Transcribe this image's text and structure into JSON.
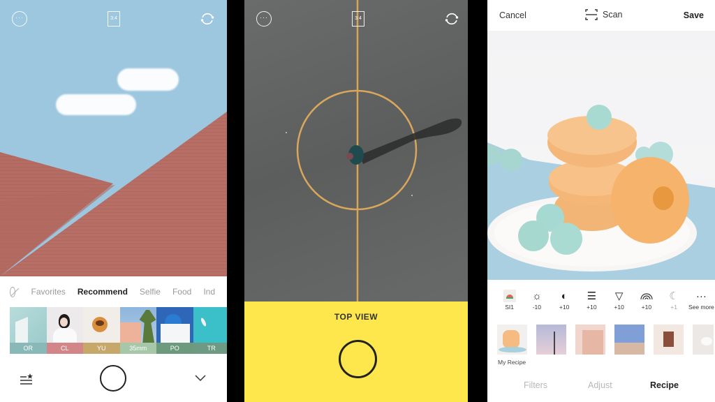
{
  "screens": {
    "camera_filters": {
      "top_bar": {
        "more_icon": "ellipsis-circle",
        "aspect_ratio": "3:4",
        "flip_camera_icon": "rotate-arrows"
      },
      "categories": [
        "Favorites",
        "Recommend",
        "Selfie",
        "Food",
        "Ind"
      ],
      "active_category": "Recommend",
      "filters": [
        {
          "label": "OR",
          "color": "#88b9b8"
        },
        {
          "label": "CL",
          "color": "#d2868a"
        },
        {
          "label": "YU",
          "color": "#c6a86a"
        },
        {
          "label": "35mm",
          "color": "#a7c7a9"
        },
        {
          "label": "PO",
          "color": "#6d9a7c"
        },
        {
          "label": "TR",
          "color": "#6e9a84"
        }
      ],
      "bottom_bar": {
        "left_icon": "list-star",
        "center_icon": "shutter",
        "right_icon": "chevron-down"
      }
    },
    "top_view_camera": {
      "top_bar": {
        "more_icon": "ellipsis-circle",
        "aspect_ratio": "3:4",
        "flip_camera_icon": "rotate-arrows"
      },
      "mode_label": "TOP VIEW",
      "accent_color": "#fde74c"
    },
    "recipe_editor": {
      "header": {
        "cancel_label": "Cancel",
        "scan_label": "Scan",
        "save_label": "Save"
      },
      "adjustments": [
        {
          "icon": "recipe-thumb",
          "value": "SI1"
        },
        {
          "icon": "brightness",
          "value": "-10"
        },
        {
          "icon": "contrast",
          "value": "+10"
        },
        {
          "icon": "structure",
          "value": "+10"
        },
        {
          "icon": "triangle",
          "value": "+10"
        },
        {
          "icon": "rainbow",
          "value": "+10"
        },
        {
          "icon": "moon",
          "value": "+1"
        },
        {
          "icon": "more",
          "value": "See more"
        }
      ],
      "recipes_label": "My Recipe",
      "tabs": [
        "Filters",
        "Adjust",
        "Recipe"
      ],
      "active_tab": "Recipe"
    }
  }
}
